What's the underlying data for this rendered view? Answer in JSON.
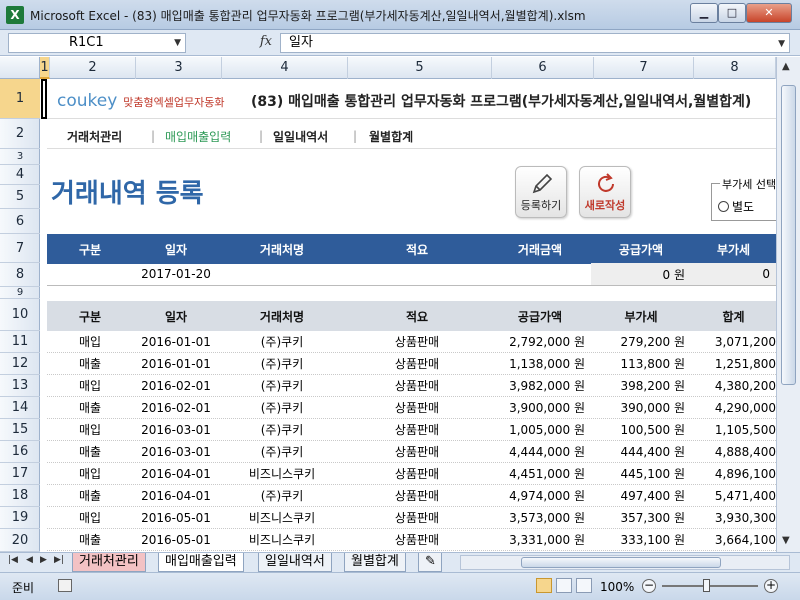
{
  "window": {
    "app_icon": "X",
    "title": "Microsoft Excel - (83) 매입매출 통합관리 업무자동화 프로그램(부가세자동계산,일일내역서,월별합계).xlsm",
    "buttons": {
      "minimize": "▁",
      "maximize": "□",
      "close": "✕"
    }
  },
  "formula_bar": {
    "name_box": "R1C1",
    "fx": "fx",
    "value": "일자"
  },
  "columns": [
    "1",
    "2",
    "3",
    "4",
    "5",
    "6",
    "7",
    "8"
  ],
  "rows": [
    "1",
    "2",
    "3",
    "4",
    "5",
    "6",
    "7",
    "8",
    "9",
    "10",
    "11",
    "12",
    "13",
    "14",
    "15",
    "16",
    "17",
    "18",
    "19",
    "20"
  ],
  "header": {
    "logo": "coukey",
    "logo_sub": "맞춤형엑셀업무자동화",
    "title": "(83) 매입매출 통합관리 업무자동화 프로그램(부가세자동계산,일일내역서,월별합계)"
  },
  "nav": {
    "items": [
      "거래처관리",
      "매입매출입력",
      "일일내역서",
      "월별합계"
    ],
    "separator": "|"
  },
  "section_title": "거래내역 등록",
  "buttons": {
    "register": "등록하기",
    "new": "새로작성"
  },
  "vat": {
    "legend": "부가세 선택",
    "option1": "별도"
  },
  "entry": {
    "headers": [
      "구분",
      "일자",
      "거래처명",
      "적요",
      "거래금액",
      "공급가액",
      "부가세"
    ],
    "row": {
      "date": "2017-01-20",
      "supply": "0 원",
      "vat": "0"
    }
  },
  "table": {
    "headers": [
      "구분",
      "일자",
      "거래처명",
      "적요",
      "공급가액",
      "부가세",
      "합계"
    ],
    "rows": [
      [
        "매입",
        "2016-01-01",
        "(주)쿠키",
        "상품판매",
        "2,792,000 원",
        "279,200 원",
        "3,071,200"
      ],
      [
        "매출",
        "2016-01-01",
        "(주)쿠키",
        "상품판매",
        "1,138,000 원",
        "113,800 원",
        "1,251,800"
      ],
      [
        "매입",
        "2016-02-01",
        "(주)쿠키",
        "상품판매",
        "3,982,000 원",
        "398,200 원",
        "4,380,200"
      ],
      [
        "매출",
        "2016-02-01",
        "(주)쿠키",
        "상품판매",
        "3,900,000 원",
        "390,000 원",
        "4,290,000"
      ],
      [
        "매입",
        "2016-03-01",
        "(주)쿠키",
        "상품판매",
        "1,005,000 원",
        "100,500 원",
        "1,105,500"
      ],
      [
        "매출",
        "2016-03-01",
        "(주)쿠키",
        "상품판매",
        "4,444,000 원",
        "444,400 원",
        "4,888,400"
      ],
      [
        "매입",
        "2016-04-01",
        "비즈니스쿠키",
        "상품판매",
        "4,451,000 원",
        "445,100 원",
        "4,896,100"
      ],
      [
        "매출",
        "2016-04-01",
        "(주)쿠키",
        "상품판매",
        "4,974,000 원",
        "497,400 원",
        "5,471,400"
      ],
      [
        "매입",
        "2016-05-01",
        "비즈니스쿠키",
        "상품판매",
        "3,573,000 원",
        "357,300 원",
        "3,930,300"
      ],
      [
        "매출",
        "2016-05-01",
        "비즈니스쿠키",
        "상품판매",
        "3,331,000 원",
        "333,100 원",
        "3,664,100"
      ]
    ]
  },
  "sheet_tabs": [
    "거래처관리",
    "매입매출입력",
    "일일내역서",
    "월별합계"
  ],
  "status": {
    "ready": "준비",
    "zoom": "100%",
    "minus": "−",
    "plus": "+"
  }
}
